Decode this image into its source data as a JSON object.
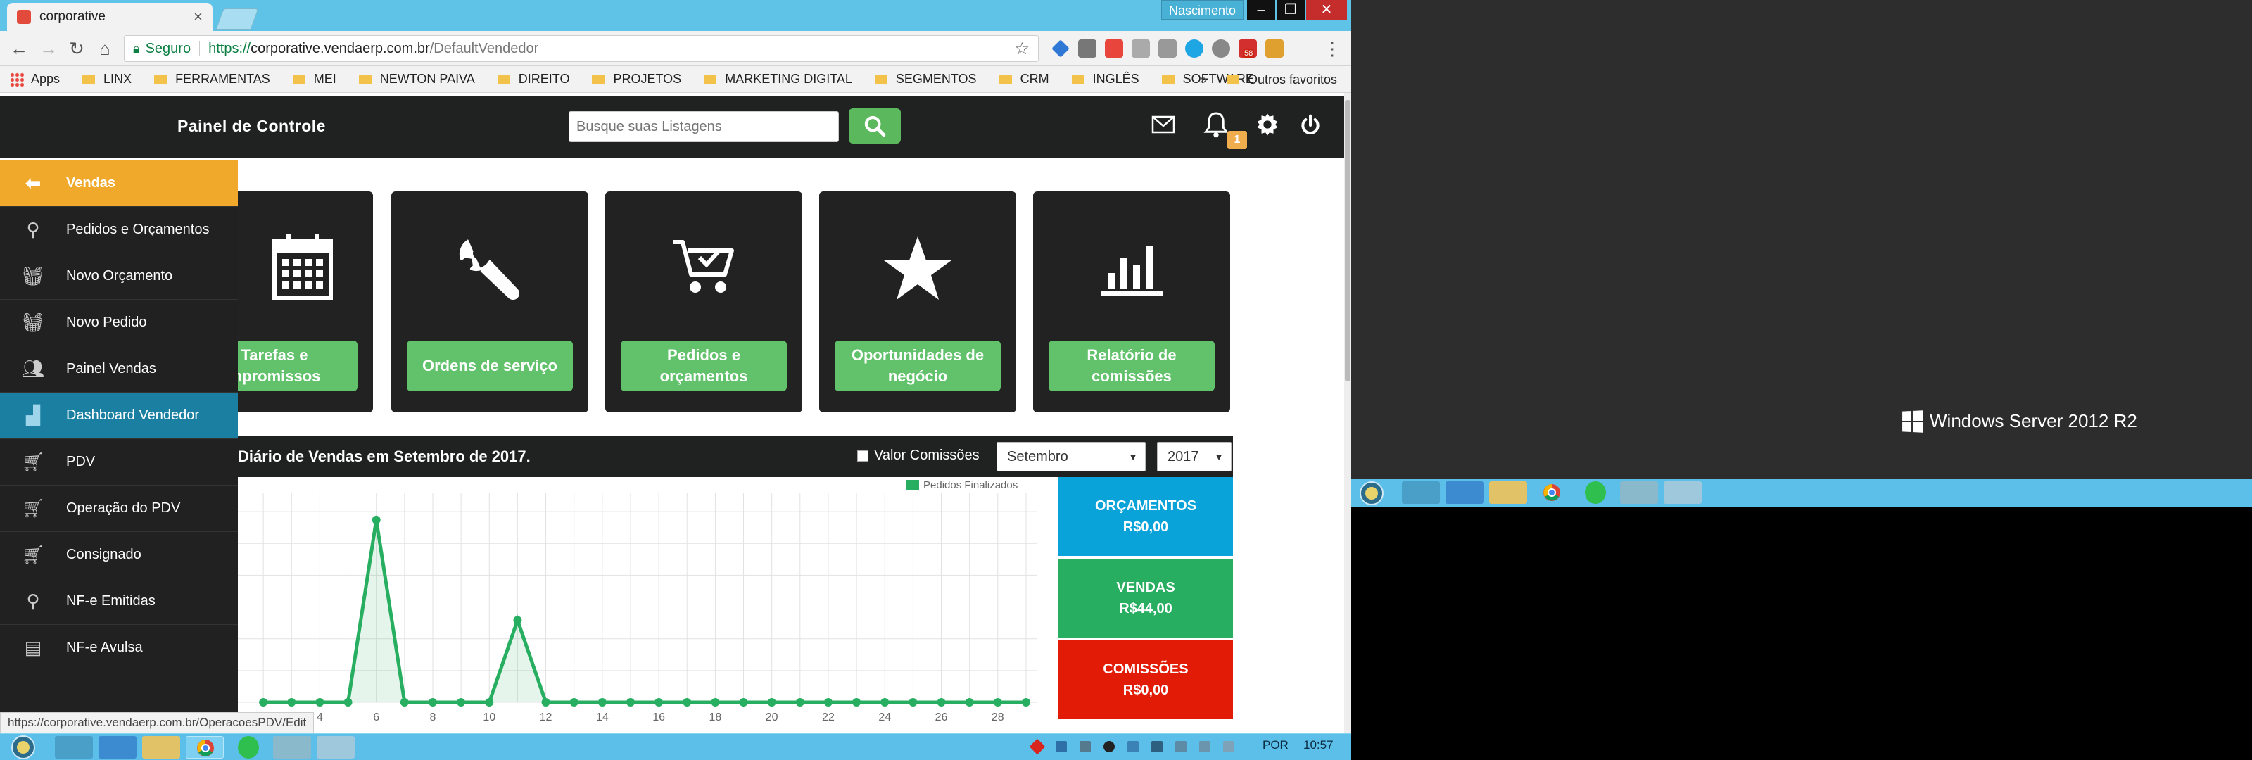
{
  "browser": {
    "tab_title": "corporative",
    "user_name": "Nascimento",
    "secure_label": "Seguro",
    "url_scheme": "https://",
    "url_host": "corporative.vendaerp.com.br",
    "url_path": "/DefaultVendedor",
    "gmail_badge": "58",
    "status_url": "https://corporative.vendaerp.com.br/OperacoesPDV/Edit",
    "bookmarks": [
      "Apps",
      "LINX",
      "FERRAMENTAS",
      "MEI",
      "NEWTON PAIVA",
      "DIREITO",
      "PROJETOS",
      "MARKETING DIGITAL",
      "SEGMENTOS",
      "CRM",
      "INGLÊS",
      "SOFTWARE"
    ],
    "bookmarks_overflow": "»",
    "other_bookmarks": "Outros favoritos"
  },
  "header": {
    "brand": "Painel de Controle",
    "search_placeholder": "Busque suas Listagens",
    "notification_count": "1"
  },
  "sidebar": {
    "items": [
      {
        "label": "Vendas",
        "icon": "arrow-left-icon",
        "state": "orange"
      },
      {
        "label": "Pedidos e Orçamentos",
        "icon": "search-icon"
      },
      {
        "label": "Novo Orçamento",
        "icon": "basket-icon"
      },
      {
        "label": "Novo Pedido",
        "icon": "basket-icon"
      },
      {
        "label": "Painel Vendas",
        "icon": "users-icon"
      },
      {
        "label": "Dashboard Vendedor",
        "icon": "bar-chart-icon",
        "state": "blue"
      },
      {
        "label": "PDV",
        "icon": "cart-icon"
      },
      {
        "label": "Operação do PDV",
        "icon": "cart-icon"
      },
      {
        "label": "Consignado",
        "icon": "cart-icon"
      },
      {
        "label": "NF-e Emitidas",
        "icon": "search-icon"
      },
      {
        "label": "NF-e Avulsa",
        "icon": "document-icon"
      }
    ]
  },
  "tiles": [
    {
      "line1": "Tarefas e",
      "line2": "mpromissos",
      "icon": "calendar-icon"
    },
    {
      "line1": "Ordens de serviço",
      "line2": "",
      "icon": "wrench-icon"
    },
    {
      "line1": "Pedidos e",
      "line2": "orçamentos",
      "icon": "cart-check-icon"
    },
    {
      "line1": "Oportunidades de",
      "line2": "negócio",
      "icon": "star-icon"
    },
    {
      "line1": "Relatório de",
      "line2": "comissões",
      "icon": "bar-chart-icon"
    }
  ],
  "chart_panel": {
    "title": "Diário de Vendas em Setembro de 2017.",
    "checkbox_label": "Valor Comissões",
    "month": "Setembro",
    "year": "2017"
  },
  "stats": [
    {
      "label": "ORÇAMENTOS",
      "value": "R$0,00",
      "color": "#0aa3d9"
    },
    {
      "label": "VENDAS",
      "value": "R$44,00",
      "color": "#27ae60"
    },
    {
      "label": "COMISSÕES",
      "value": "R$0,00",
      "color": "#e21b07"
    }
  ],
  "chart_data": {
    "type": "area",
    "title": "",
    "xlabel": "",
    "ylabel": "",
    "x_ticks": [
      "4",
      "6",
      "8",
      "10",
      "12",
      "14",
      "16",
      "18",
      "20",
      "22",
      "24",
      "26",
      "28"
    ],
    "series": [
      {
        "name": "Pedidos Finalizados",
        "color": "#27ae60",
        "x": [
          2,
          3,
          4,
          5,
          6,
          7,
          8,
          9,
          10,
          11,
          12,
          13,
          14,
          15,
          16,
          17,
          18,
          19,
          20,
          21,
          22,
          23,
          24,
          25,
          26,
          27,
          28,
          29
        ],
        "y": [
          0,
          0,
          0,
          0,
          1,
          0,
          0,
          0,
          0,
          0.45,
          0,
          0,
          0,
          0,
          0,
          0,
          0,
          0,
          0,
          0,
          0,
          0,
          0,
          0,
          0,
          0,
          0,
          0
        ]
      }
    ],
    "xlim": [
      1.1,
      29.4
    ],
    "ylim": [
      0,
      1.15
    ],
    "grid": true,
    "legend": "top-right"
  },
  "taskbar": {
    "language": "POR",
    "time": "10:57"
  },
  "desktop": {
    "os_label": "Windows Server 2012 R2"
  }
}
